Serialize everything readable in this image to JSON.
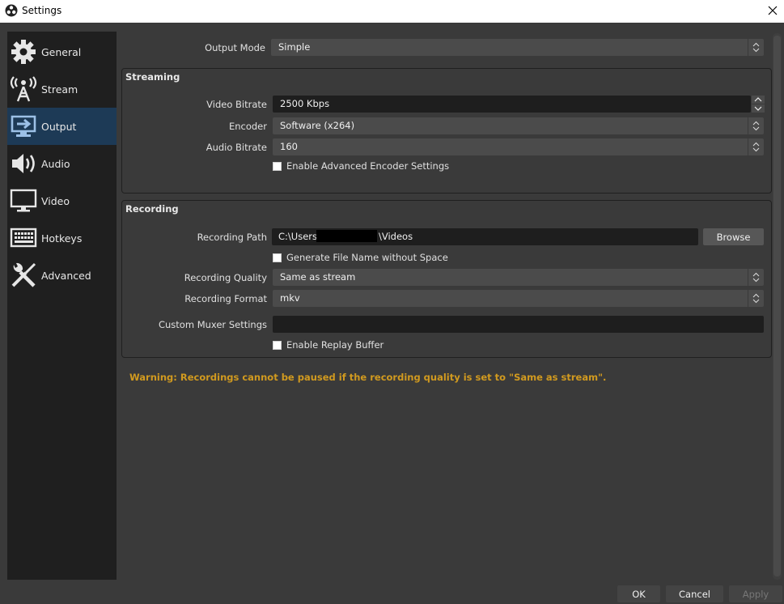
{
  "window": {
    "title": "Settings",
    "app_icon": "obs-logo-icon",
    "close_icon": "close-icon"
  },
  "sidebar": {
    "items": [
      {
        "label": "General",
        "icon": "gear-icon",
        "selected": false
      },
      {
        "label": "Stream",
        "icon": "broadcast-tower-icon",
        "selected": false
      },
      {
        "label": "Output",
        "icon": "monitor-arrow-icon",
        "selected": true
      },
      {
        "label": "Audio",
        "icon": "speaker-icon",
        "selected": false
      },
      {
        "label": "Video",
        "icon": "monitor-icon",
        "selected": false
      },
      {
        "label": "Hotkeys",
        "icon": "keyboard-icon",
        "selected": false
      },
      {
        "label": "Advanced",
        "icon": "wrench-screwdriver-icon",
        "selected": false
      }
    ]
  },
  "output_mode": {
    "label": "Output Mode",
    "value": "Simple"
  },
  "streaming": {
    "title": "Streaming",
    "video_bitrate": {
      "label": "Video Bitrate",
      "value": "2500 Kbps"
    },
    "encoder": {
      "label": "Encoder",
      "value": "Software (x264)"
    },
    "audio_bitrate": {
      "label": "Audio Bitrate",
      "value": "160"
    },
    "advanced_encoder": {
      "label": "Enable Advanced Encoder Settings",
      "checked": false
    }
  },
  "recording": {
    "title": "Recording",
    "path": {
      "label": "Recording Path",
      "value_prefix": "C:\\Users\\",
      "value_suffix": "\\Videos",
      "redacted": true
    },
    "browse_label": "Browse",
    "no_space": {
      "label": "Generate File Name without Space",
      "checked": false
    },
    "quality": {
      "label": "Recording Quality",
      "value": "Same as stream"
    },
    "format": {
      "label": "Recording Format",
      "value": "mkv"
    },
    "muxer": {
      "label": "Custom Muxer Settings",
      "value": ""
    },
    "replay_buffer": {
      "label": "Enable Replay Buffer",
      "checked": false
    }
  },
  "warning": "Warning: Recordings cannot be paused if the recording quality is set to \"Same as stream\".",
  "footer": {
    "ok": "OK",
    "cancel": "Cancel",
    "apply": "Apply"
  },
  "colors": {
    "selected_bg": "#1d3a56",
    "warning": "#d19a1f",
    "sidebar_bg": "#1f1f1f",
    "window_bg": "#3a3a3a"
  }
}
